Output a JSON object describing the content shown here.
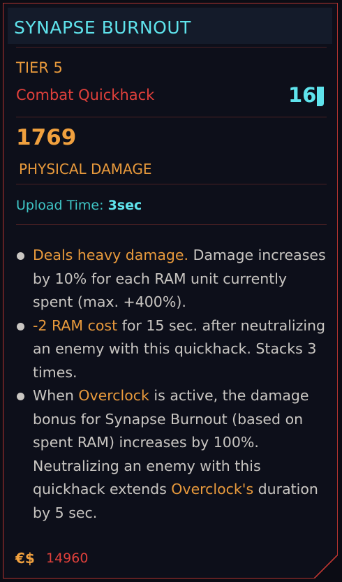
{
  "header": {
    "title": "SYNAPSE BURNOUT"
  },
  "info": {
    "tier": "TIER 5",
    "type": "Combat Quickhack",
    "ram_cost": "16"
  },
  "damage": {
    "value": "1769",
    "type": "PHYSICAL DAMAGE"
  },
  "upload": {
    "label": "Upload Time:",
    "value": "3sec"
  },
  "effects": [
    {
      "parts": [
        {
          "text": "Deals heavy damage.",
          "hl": true
        },
        {
          "text": " Damage increases by 10% for each RAM unit currently spent (max. +400%).",
          "hl": false
        }
      ]
    },
    {
      "parts": [
        {
          "text": "-2 RAM cost",
          "hl": true
        },
        {
          "text": " for 15 sec. after neutralizing an enemy with this quickhack. Stacks 3 times.",
          "hl": false
        }
      ]
    },
    {
      "parts": [
        {
          "text": "When ",
          "hl": false
        },
        {
          "text": "Overclock",
          "hl": true
        },
        {
          "text": " is active, the damage bonus for Synapse Burnout (based on spent RAM) increases by 100%. Neutralizing an enemy with this quickhack extends ",
          "hl": false
        },
        {
          "text": "Overclock's",
          "hl": true
        },
        {
          "text": " duration by 5 sec.",
          "hl": false
        }
      ]
    }
  ],
  "price": {
    "currency": "€$",
    "value": "14960"
  },
  "colors": {
    "accent_cyan": "#5fe3ec",
    "highlight_orange": "#e99a3c",
    "type_red": "#e0403b",
    "border_red": "#b2332f"
  }
}
